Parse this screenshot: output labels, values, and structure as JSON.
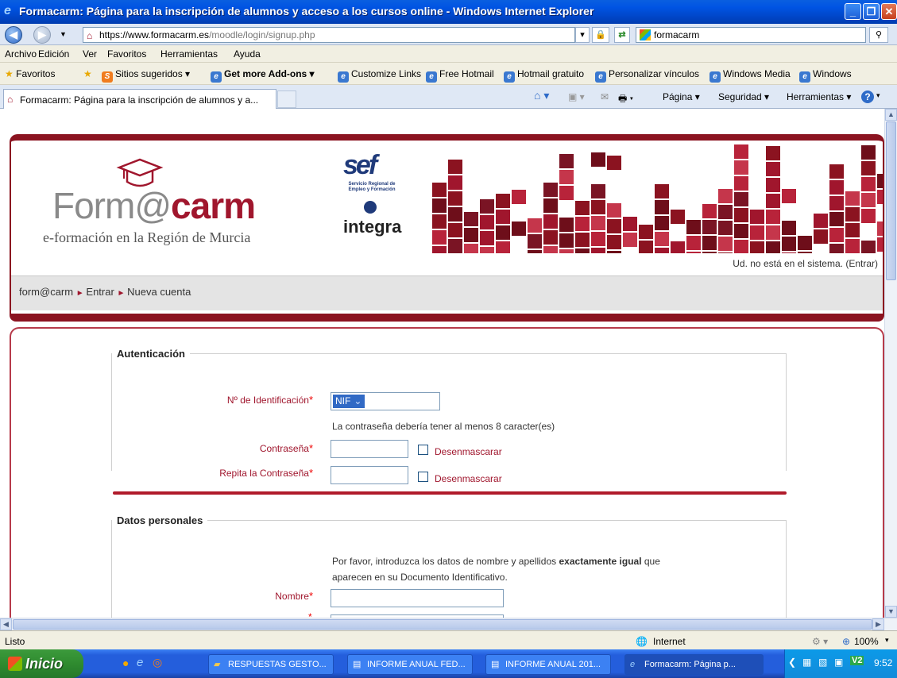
{
  "window": {
    "title": "Formacarm: Página para la inscripción de alumnos y acceso a los cursos online - Windows Internet Explorer"
  },
  "addressbar": {
    "url_prefix": "https://",
    "url_domain": "www.formacarm.es",
    "url_path": "/moodle/login/signup.php",
    "search_value": "formacarm"
  },
  "menu": [
    "Archivo",
    "Edición",
    "Ver",
    "Favoritos",
    "Herramientas",
    "Ayuda"
  ],
  "favorites": {
    "label": "Favoritos",
    "items": [
      "Sitios sugeridos ▾",
      "Get more Add-ons ▾",
      "Customize Links",
      "Free Hotmail",
      "Hotmail gratuito",
      "Personalizar vínculos",
      "Windows Media",
      "Windows"
    ]
  },
  "tab": {
    "label": "Formacarm: Página para la inscripción de alumnos y a...",
    "commands": [
      "Página ▾",
      "Seguridad ▾",
      "Herramientas ▾"
    ]
  },
  "header": {
    "logo_part1": "Form",
    "logo_part2": "@",
    "logo_part3": "carm",
    "logo_subtitle": "e-formación en la Región de Murcia",
    "sef_name": "Servicio Regional de Empleo y Formación",
    "integra": "integra",
    "login_status": "Ud. no está en el sistema. (Entrar)"
  },
  "breadcrumb": [
    "form@carm",
    "Entrar",
    "Nueva cuenta"
  ],
  "auth": {
    "legend": "Autenticación",
    "id_label": "Nº de Identificación",
    "id_type": "NIF",
    "password_hint": "La contraseña debería tener al menos 8 caracter(es)",
    "password_label": "Contraseña",
    "repeat_label": "Repita la Contraseña",
    "unmask_label": "Desenmascarar"
  },
  "personal": {
    "legend": "Datos personales",
    "note_part1": "Por favor, introduzca los datos de nombre y apellidos ",
    "note_bold": "exactamente igual",
    "note_part2": " que",
    "note_line2": "aparecen en su Documento Identificativo.",
    "name_label": "Nombre"
  },
  "status": {
    "text": "Listo",
    "zone": "Internet",
    "zoom": "100%"
  },
  "taskbar": {
    "start": "Inicio",
    "tasks": [
      "RESPUESTAS GESTO...",
      "INFORME ANUAL FED...",
      "INFORME ANUAL 201...",
      "Formacarm: Página p..."
    ],
    "time": "9:52"
  }
}
